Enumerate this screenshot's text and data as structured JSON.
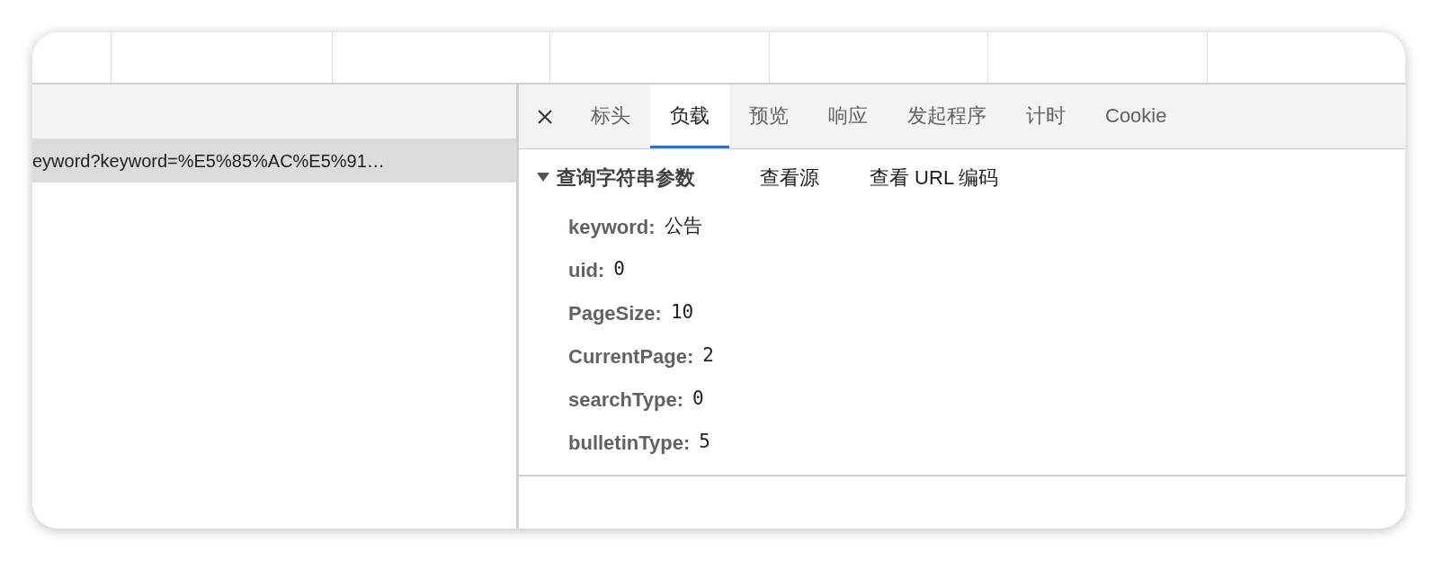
{
  "request_list": {
    "rows": [
      {
        "name": "eyword?keyword=%E5%85%AC%E5%91…",
        "selected": true
      }
    ]
  },
  "tabs": [
    {
      "label": "标头",
      "selected": false
    },
    {
      "label": "负载",
      "selected": true
    },
    {
      "label": "预览",
      "selected": false
    },
    {
      "label": "响应",
      "selected": false
    },
    {
      "label": "发起程序",
      "selected": false
    },
    {
      "label": "计时",
      "selected": false
    },
    {
      "label": "Cookie",
      "selected": false
    }
  ],
  "section": {
    "title": "查询字符串参数",
    "expanded": true,
    "actions": [
      "查看源",
      "查看 URL 编码"
    ],
    "params": [
      {
        "key": "keyword:",
        "value": "公告"
      },
      {
        "key": "uid:",
        "value": "0"
      },
      {
        "key": "PageSize:",
        "value": "10"
      },
      {
        "key": "CurrentPage:",
        "value": "2"
      },
      {
        "key": "searchType:",
        "value": "0"
      },
      {
        "key": "bulletinType:",
        "value": "5"
      }
    ]
  }
}
